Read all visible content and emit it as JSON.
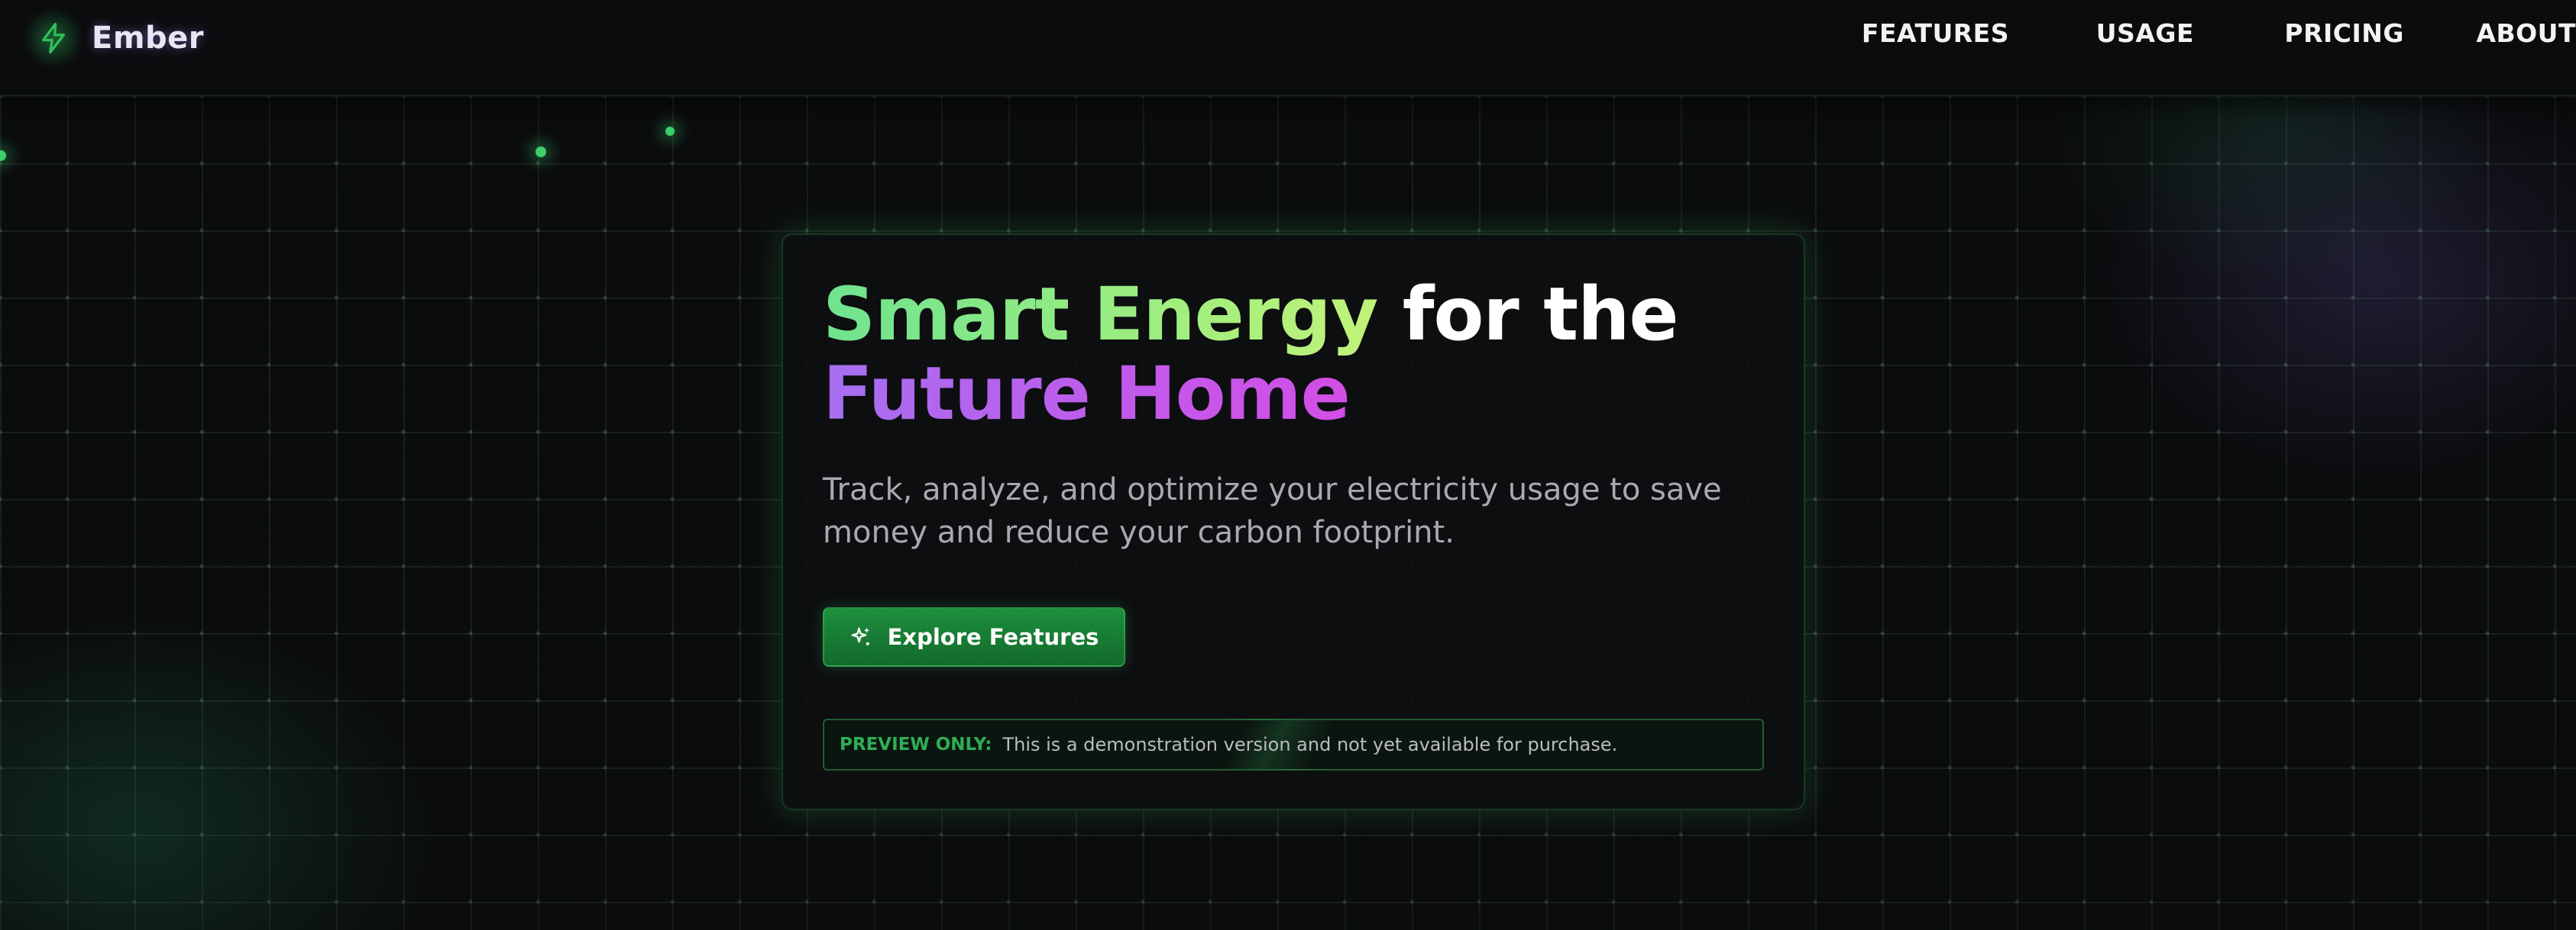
{
  "header": {
    "brand_name": "Ember",
    "brand_icon": "lightning-bolt-icon",
    "nav": [
      {
        "label": "FEATURES"
      },
      {
        "label": "USAGE"
      },
      {
        "label": "PRICING"
      },
      {
        "label": "ABOUT"
      }
    ]
  },
  "hero": {
    "headline_part1": "Smart Energy",
    "headline_part2": "for the",
    "headline_part3": "Future Home",
    "subtitle": "Track, analyze, and optimize your electricity usage to save money and reduce your carbon footprint.",
    "cta_label": "Explore Features",
    "cta_icon": "sparkle-icon",
    "notice_label": "PREVIEW ONLY:",
    "notice_text": "This is a demonstration version and not yet available for purchase."
  },
  "colors": {
    "background": "#0b0c0e",
    "accent_green": "#6fe38f",
    "accent_purple": "#c259ea",
    "button_green": "#1c8f3c",
    "notice_label_green": "#2fae55"
  }
}
